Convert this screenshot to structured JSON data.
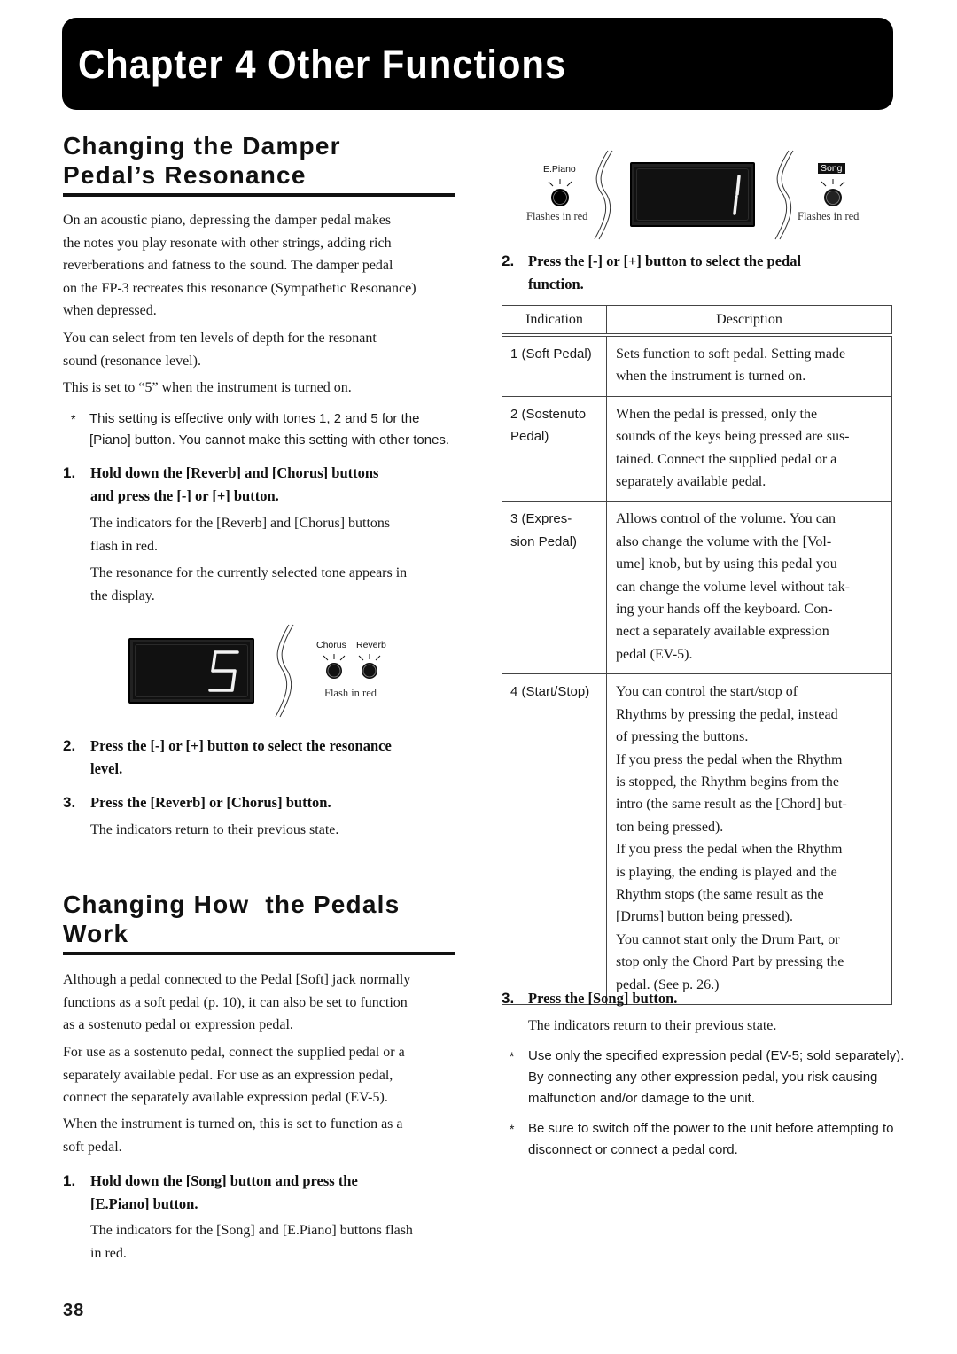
{
  "chapter": {
    "title": "Chapter 4 Other Functions"
  },
  "damper_section": {
    "heading_line1": "Changing the Damper",
    "heading_line2": "Pedal’s Resonance",
    "intro_lines": [
      "On an acoustic piano, depressing the damper pedal makes",
      "the notes you play resonate with other strings, adding rich",
      "reverberations and fatness to the sound. The damper pedal",
      "on the FP-3 recreates this resonance (Sympathetic Resonance)",
      "when depressed."
    ],
    "levels_lines": [
      "You can select from ten levels of depth for the resonant",
      "sound (resonance level)."
    ],
    "default_text": "This is set to “5” when the instrument is turned on.",
    "note": {
      "bullet": "*",
      "lines": [
        "This setting is effective only with tones 1, 2 and 5 for the",
        "[Piano] button. You cannot make this setting with other tones."
      ]
    },
    "steps": [
      {
        "number": "1.",
        "title_lines": [
          "Hold down the [Reverb] and [Chorus] buttons",
          "and press the [-] or [+] button."
        ],
        "body": [
          [
            "The indicators for the [Reverb] and [Chorus] buttons",
            "flash in red."
          ],
          [
            "The resonance for the currently selected tone appears in",
            "the display."
          ]
        ]
      },
      {
        "number": "2.",
        "title_lines": [
          "Press the [-] or [+] button to select the resonance",
          "level."
        ]
      },
      {
        "number": "3.",
        "title_lines": [
          "Press the [Reverb] or [Chorus] button."
        ],
        "body": [
          [
            "The indicators return to their previous state."
          ]
        ]
      }
    ],
    "illustration": {
      "display_value": "5",
      "buttons": [
        "Chorus",
        "Reverb"
      ],
      "caption": "Flash in red"
    }
  },
  "pedals_section": {
    "heading_line1": "Changing How  the Pedals",
    "heading_line2": "Work",
    "para1_lines": [
      "Although a pedal connected to the Pedal [Soft] jack normally",
      "functions as a soft pedal (p. 10), it can also be set to function",
      "as a sostenuto pedal or expression pedal."
    ],
    "para2_lines": [
      "For use as a sostenuto pedal, connect the supplied pedal or a",
      "separately available pedal. For use as an expression pedal,",
      "connect the separately available expression pedal (EV-5)."
    ],
    "para3_lines": [
      "When the instrument is turned on, this is set to function as a",
      "soft pedal."
    ],
    "steps": [
      {
        "number": "1.",
        "title_lines": [
          "Hold down the [Song] button and press the",
          "[E.Piano] button."
        ],
        "body": [
          [
            "The indicators for the [Song] and [E.Piano] buttons flash",
            "in red."
          ]
        ]
      },
      {
        "number": "2.",
        "title_lines": [
          "Press the [-] or [+] button to select the pedal",
          "function."
        ]
      },
      {
        "number": "3.",
        "title_lines": [
          "Press the [Song] button."
        ],
        "body": [
          [
            "The indicators return to their previous state."
          ]
        ]
      }
    ],
    "illustration": {
      "left_button": "E.Piano",
      "left_caption": "Flashes in red",
      "display_value": "1",
      "right_button": "Song",
      "right_caption": "Flashes in red"
    },
    "table": {
      "headers": [
        "Indication",
        "Description"
      ],
      "rows": [
        {
          "indication": [
            "1 (Soft Pedal)"
          ],
          "description": [
            "Sets function to soft pedal. Setting made",
            "when the instrument is turned on."
          ]
        },
        {
          "indication": [
            "2 (Sostenuto",
            "Pedal)"
          ],
          "description": [
            "When the pedal is pressed, only the",
            "sounds of the keys being pressed are sus-",
            "tained. Connect the supplied pedal or a",
            "separately available pedal."
          ]
        },
        {
          "indication": [
            "3 (Expres-",
            "sion Pedal)"
          ],
          "description": [
            "Allows control of the volume. You can",
            "also change the volume with the [Vol-",
            "ume] knob, but by using this pedal you",
            "can change the volume level without tak-",
            "ing your hands off the keyboard. Con-",
            "nect a separately available expression",
            "pedal (EV-5)."
          ]
        },
        {
          "indication": [
            "4 (Start/Stop)"
          ],
          "description": [
            "You can control the start/stop of",
            "Rhythms by pressing the pedal, instead",
            "of pressing the buttons.",
            "If you press the pedal when the Rhythm",
            "is stopped, the Rhythm begins from the",
            "intro (the same result as the [Chord] but-",
            "ton being pressed).",
            "If you press the pedal when the Rhythm",
            "is playing, the ending is played and the",
            "Rhythm stops (the same result as the",
            "[Drums] button being pressed).",
            "You cannot start only the Drum Part, or",
            "stop only the Chord Part by pressing the",
            "pedal. (See p. 26.)"
          ]
        }
      ]
    },
    "notes": [
      {
        "bullet": "*",
        "lines": [
          "Use only the specified expression pedal (EV-5; sold separately).",
          "By connecting any other expression pedal, you risk causing",
          "malfunction and/or damage to the unit."
        ]
      },
      {
        "bullet": "*",
        "lines": [
          "Be sure to switch off the power to the unit before attempting to",
          "disconnect or connect a pedal cord."
        ]
      }
    ]
  },
  "page_number": "38"
}
